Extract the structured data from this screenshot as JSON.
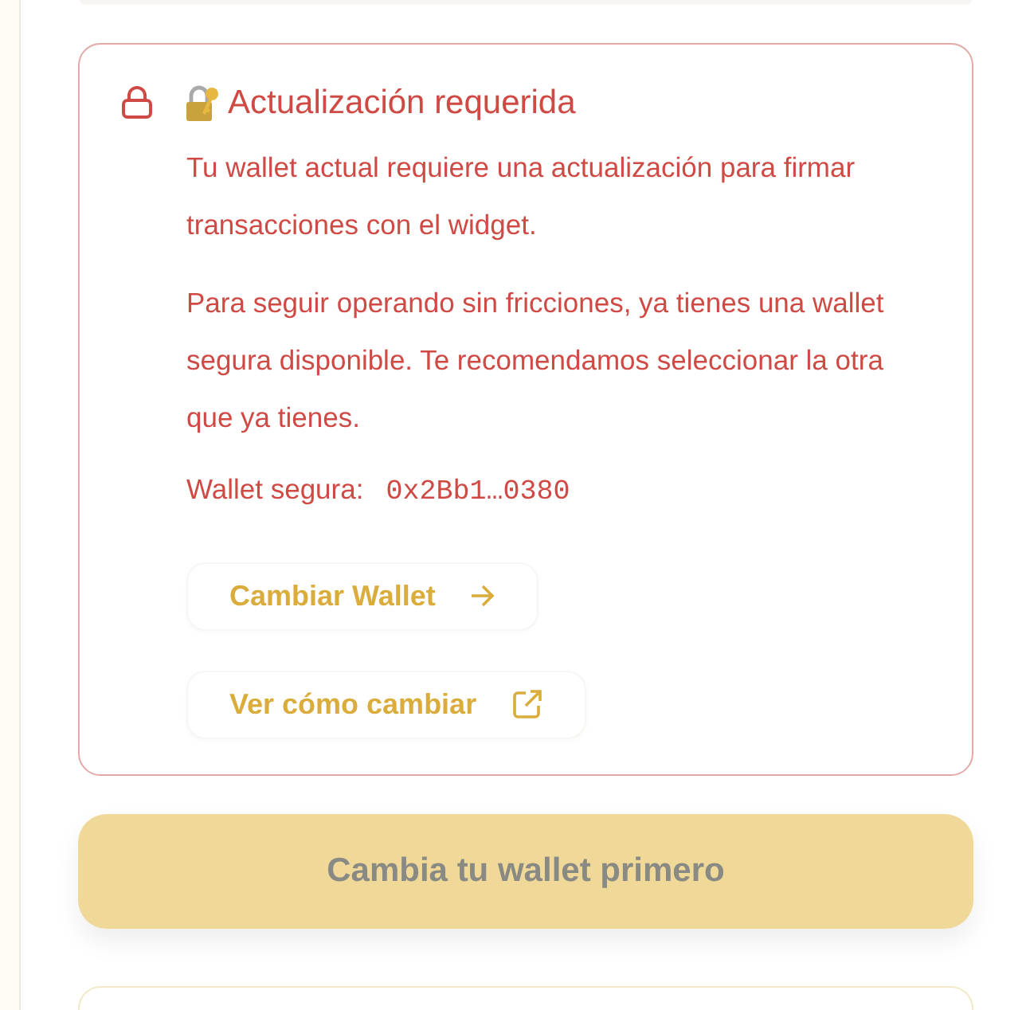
{
  "alert": {
    "title": "Actualización requerida",
    "paragraphs": [
      "Tu wallet actual requiere una actualización para firmar transacciones con el widget.",
      "Para seguir operando sin fricciones, ya tienes una wallet segura disponible. Te recomendamos seleccionar la otra que ya tienes."
    ],
    "wallet_label": "Wallet segura:",
    "wallet_address": "0x2Bb1…0380",
    "actions": [
      {
        "label": "Cambiar Wallet",
        "kind": "next"
      },
      {
        "label": "Ver cómo cambiar",
        "kind": "external"
      }
    ]
  },
  "primary_button": {
    "label": "Cambia tu wallet primero",
    "disabled": true
  }
}
